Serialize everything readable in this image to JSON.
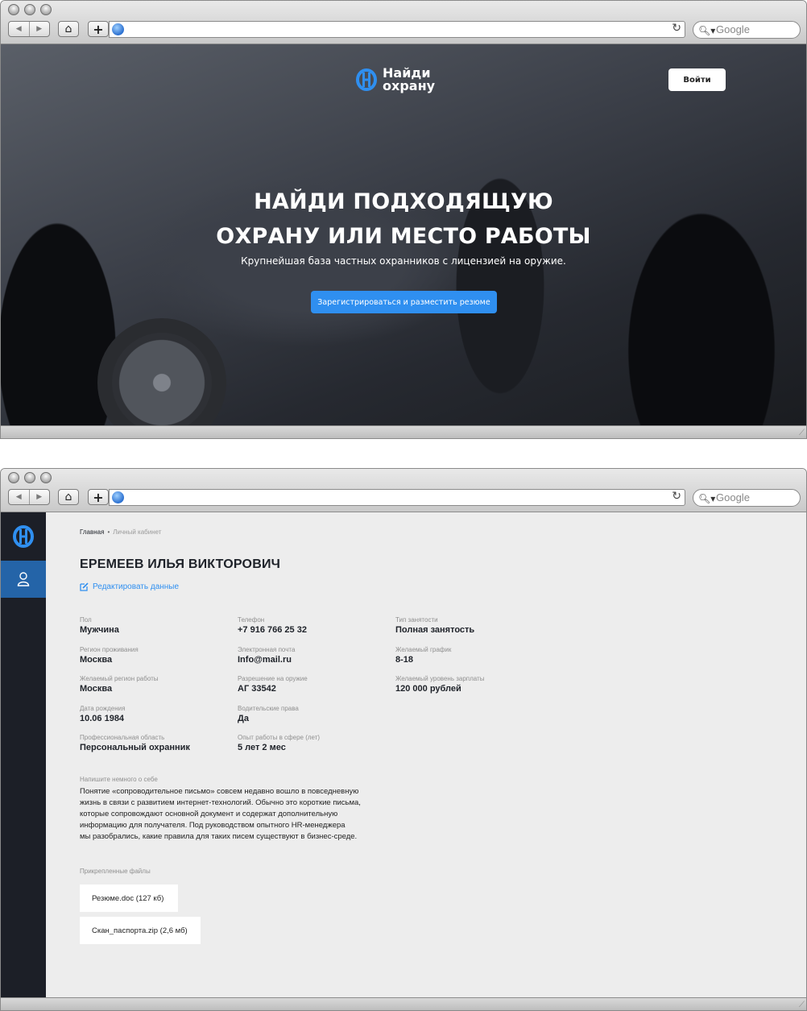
{
  "browser": {
    "search_placeholder": "Google"
  },
  "landing": {
    "logo_text": "Найди охрану",
    "login_button": "Войти",
    "title_line1": "НАЙДИ ПОДХОДЯЩУЮ",
    "title_line2": "ОХРАНУ ИЛИ МЕСТО РАБОТЫ",
    "subtitle": "Крупнейшая база частных охранников с лицензией на оружие.",
    "cta_button": "Зарегистрироваться и разместить резюме"
  },
  "cabinet": {
    "breadcrumb": {
      "home": "Главная",
      "separator": "•",
      "current": "Личный кабинет"
    },
    "name": "ЕРЕМЕЕВ ИЛЬЯ ВИКТОРОВИЧ",
    "edit_link": "Редактировать данные",
    "columns": [
      [
        {
          "label": "Пол",
          "value": "Мужчина"
        },
        {
          "label": "Регион проживания",
          "value": "Москва"
        },
        {
          "label": "Желаемый регион работы",
          "value": "Москва"
        },
        {
          "label": "Дата рождения",
          "value": "10.06 1984"
        },
        {
          "label": "Профессиональная область",
          "value": "Персональный охранник"
        }
      ],
      [
        {
          "label": "Телефон",
          "value": "+7 916 766 25 32"
        },
        {
          "label": "Электронная почта",
          "value": "Info@mail.ru"
        },
        {
          "label": "Разрешение на оружие",
          "value": "АГ 33542"
        },
        {
          "label": "Водительские права",
          "value": "Да"
        },
        {
          "label": "Опыт работы в сфере (лет)",
          "value": "5 лет 2 мес"
        }
      ],
      [
        {
          "label": "Тип занятости",
          "value": "Полная занятость"
        },
        {
          "label": "Желаемый график",
          "value": "8-18"
        },
        {
          "label": "Желаемый уровень зарплаты",
          "value": "120 000 рублей"
        }
      ]
    ],
    "about_label": "Напишите немного о себе",
    "about_lines": [
      "Понятие «сопроводительное письмо» совсем недавно вошло в повседневную",
      "жизнь в связи с развитием интернет-технологий. Обычно это короткие письма,",
      "которые сопровождают основной документ и содержат дополнительную",
      "информацию для получателя. Под руководством опытного HR-менеджера",
      "мы разобрались, какие правила для таких писем существуют в бизнес-среде."
    ],
    "files_label": "Прикрепленные файлы",
    "files": [
      "Резюме.doc (127 кб)",
      "Скан_паспорта.zip (2,6 мб)"
    ]
  },
  "colors": {
    "accent": "#2f8ff0",
    "sidebar": "#1c1f27",
    "sidebar_active": "#2464a8",
    "content_bg": "#ededed"
  },
  "icons": [
    "back-icon",
    "forward-icon",
    "home-icon",
    "add-tab-icon",
    "globe-icon",
    "reload-icon",
    "search-icon",
    "logo-icon",
    "user-icon",
    "edit-icon",
    "resize-grip-icon"
  ]
}
